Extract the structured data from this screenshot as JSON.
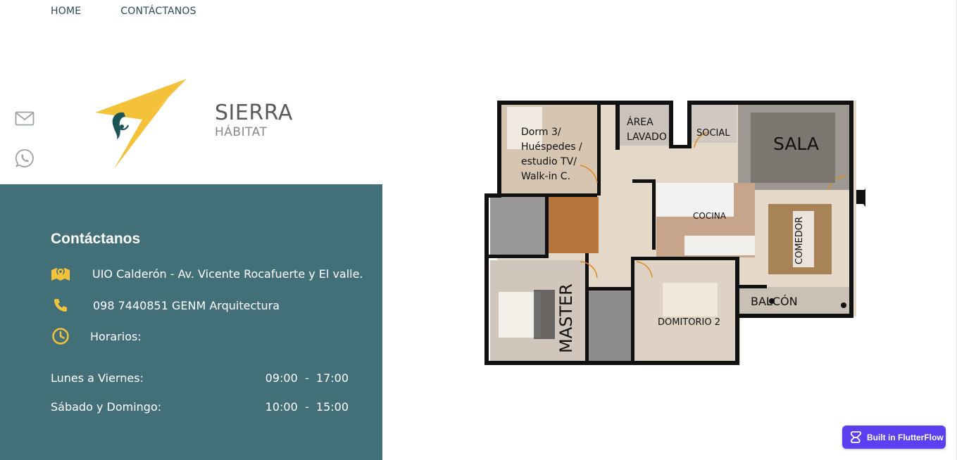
{
  "nav": {
    "home": "HOME",
    "contact": "CONTÁCTANOS"
  },
  "side_icons": [
    "mail-icon",
    "whatsapp-icon"
  ],
  "brand": {
    "name": "SIERRA",
    "subtitle": "HÁBITAT"
  },
  "contact": {
    "title": "Contáctanos",
    "address": "UIO Calderón - Av. Vicente Rocafuerte y El valle.",
    "phone": "098 7440851 GENM Arquitectura",
    "hours_label": "Horarios:",
    "schedule": [
      {
        "days": "Lunes a Viernes:",
        "time": "09:00  -  17:00"
      },
      {
        "days": "Sábado y Domingo:",
        "time": "10:00  -  15:00"
      }
    ]
  },
  "floorplan": {
    "dorm3_line1": "Dorm 3/",
    "dorm3_line2": "Huéspedes /",
    "dorm3_line3": "estudio TV/",
    "dorm3_line4": "Walk-in C.",
    "area_line1": "ÁREA",
    "area_line2": "LAVADO",
    "social": "SOCIAL",
    "sala": "SALA",
    "cocina": "COCINA",
    "comedor": "COMEDOR",
    "master": "MASTER",
    "domitorio": "DOMITORIO 2",
    "balcon": "BALCÓN"
  },
  "badge": {
    "label": "Built in FlutterFlow"
  },
  "colors": {
    "panel": "#436f79",
    "accent": "#f3c23a",
    "badge": "#5b3ff0",
    "nav_text": "#2b4a55"
  }
}
